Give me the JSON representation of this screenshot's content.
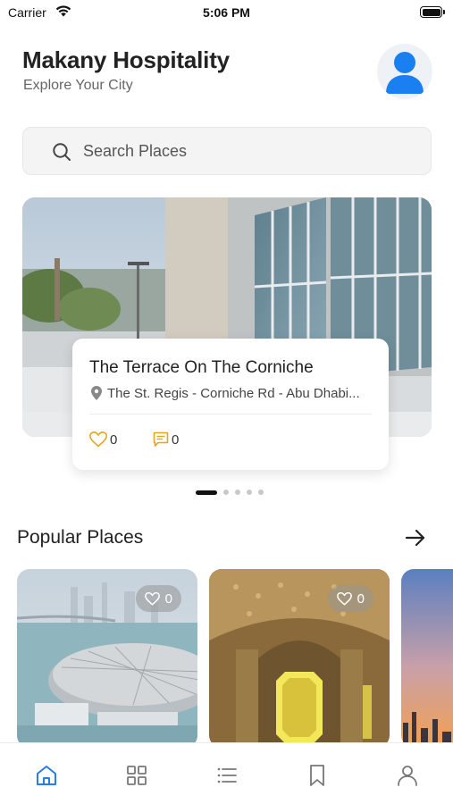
{
  "status_bar": {
    "carrier": "Carrier",
    "time": "5:06 PM"
  },
  "header": {
    "title": "Makany Hospitality",
    "subtitle": "Explore Your City"
  },
  "search": {
    "placeholder": "Search Places"
  },
  "featured": {
    "title": "The Terrace On The Corniche",
    "address": "The St. Regis - Corniche Rd - Abu Dhabi...",
    "likes": "0",
    "comments": "0",
    "carousel_dots": 5,
    "active_dot": 0
  },
  "popular": {
    "title": "Popular Places",
    "cards": [
      {
        "likes": "0"
      },
      {
        "likes": "0"
      }
    ]
  },
  "colors": {
    "accent": "#2a7de1",
    "like": "#e6a520",
    "comment": "#e6a520",
    "inactive_icon": "#777777"
  },
  "icons": [
    "wifi-icon",
    "battery-icon",
    "avatar-icon",
    "search-icon",
    "location-pin-icon",
    "heart-icon",
    "comment-icon",
    "arrow-right-icon",
    "home-icon",
    "grid-icon",
    "list-icon",
    "bookmark-icon",
    "profile-icon"
  ]
}
